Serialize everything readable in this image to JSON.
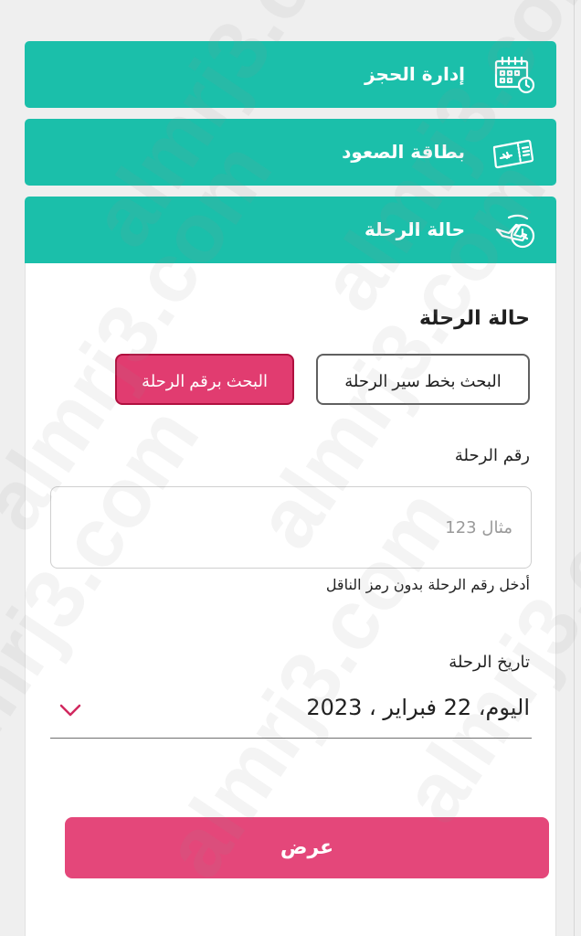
{
  "nav": {
    "manage_booking": "إدارة الحجز",
    "boarding_pass": "بطاقة الصعود",
    "flight_status": "حالة الرحلة"
  },
  "status_form": {
    "title": "حالة الرحلة",
    "tabs": {
      "by_route": "البحث بخط سير الرحلة",
      "by_flight_number": "البحث برقم الرحلة",
      "active": "by_flight_number"
    },
    "flight_number": {
      "label": "رقم الرحلة",
      "placeholder": "مثال 123",
      "value": "",
      "helper": "أدخل رقم الرحلة بدون رمز الناقل"
    },
    "flight_date": {
      "label": "تاريخ الرحلة",
      "value": "اليوم، 22 فبراير ، 2023"
    },
    "submit_label": "عرض"
  },
  "watermark": {
    "text": "almrj3.com"
  },
  "colors": {
    "teal": "#1BBFAA",
    "pink": "#E4477A",
    "pink_border": "#B0103F",
    "background": "#EFEFEF",
    "text": "#202020"
  },
  "icons": {
    "manage_booking": "calendar-clock-icon",
    "boarding_pass": "boarding-pass-icon",
    "flight_status": "plane-clock-icon",
    "date_select": "chevron-down-icon"
  }
}
